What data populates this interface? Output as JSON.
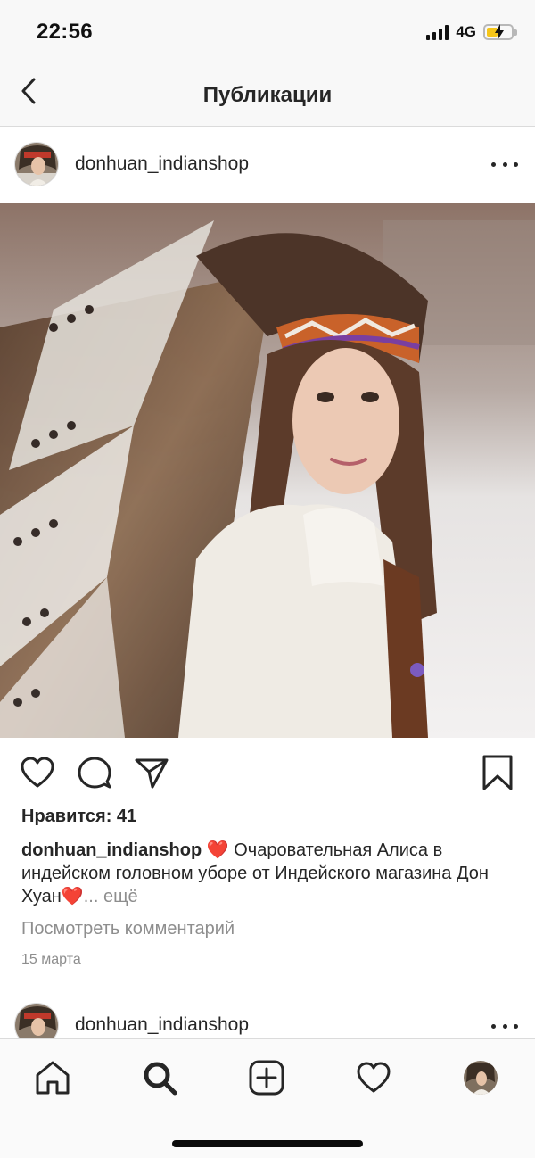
{
  "status_bar": {
    "time": "22:56",
    "network": "4G",
    "battery_color": "#f5c518"
  },
  "nav": {
    "title": "Публикации",
    "back_icon": "chevron-left-icon"
  },
  "post": {
    "username": "donhuan_indianshop",
    "photo_alt": "photo",
    "likes_text": "Нравится: 41",
    "caption": {
      "username": "donhuan_indianshop",
      "emoji_1": "❤️",
      "text": " Очаровательная Алиса в индейском головном уборе от Индейского магазина Дон Хуан",
      "emoji_2": "❤️",
      "more_label": "... ещё"
    },
    "view_comments": "Посмотреть комментарий",
    "date": "15 марта"
  },
  "next_post": {
    "username": "donhuan_indianshop"
  },
  "tabbar": {
    "items": [
      "home-icon",
      "search-icon",
      "new-post-icon",
      "activity-heart-icon",
      "profile-avatar"
    ]
  },
  "colors": {
    "text": "#262626",
    "secondary": "#8e8e8e",
    "border": "#dbdbdb",
    "heart": "#e0202f"
  }
}
